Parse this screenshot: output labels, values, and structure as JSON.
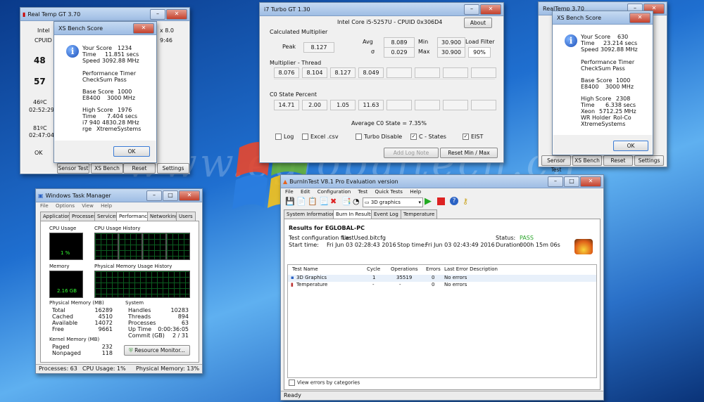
{
  "desktop": {
    "watermark": "www.eglobaltech.cn"
  },
  "realtemp_left": {
    "title": "Real Temp GT 3.70",
    "intel_label": "Intel",
    "cpuid_label": "CPUID",
    "frag_x8": "x 8.0",
    "frag_46": "9:46",
    "temp1": "48",
    "temp2": "57",
    "min_temp": "46ºC",
    "min_time": "02:52:29",
    "max_temp": "81ºC",
    "max_time": "02:47:04",
    "ok": "OK",
    "buttons": {
      "sensor_test": "Sensor Test",
      "xs_bench": "XS Bench",
      "reset": "Reset",
      "settings": "Settings"
    }
  },
  "xs_bench_left": {
    "title": "XS Bench Score",
    "your_score_label": "Your Score",
    "your_score": "1234",
    "time_label": "Time",
    "time": "11.851 secs",
    "speed_label": "Speed",
    "speed": "3092.88 MHz",
    "perf_timer": "Performance Timer",
    "checksum": "CheckSum Pass",
    "base_score_label": "Base Score",
    "base_score": "1000",
    "base_cpu": "E8400",
    "base_mhz": "3000 MHz",
    "high_score_label": "High Score",
    "high_score": "1976",
    "high_time_label": "Time",
    "high_time": "7.404 secs",
    "high_cpu": "i7 940",
    "high_mhz": "4830.28 MHz",
    "holder": "rge",
    "holder_name": "XtremeSystems",
    "ok": "OK"
  },
  "i7turbo": {
    "title": "i7 Turbo GT 1.30",
    "cpu_info": "Intel Core i5-5257U  -  CPUID 0x306D4",
    "about": "About",
    "calc_mult": "Calculated Multiplier",
    "peak_label": "Peak",
    "peak": "8.127",
    "avg_label": "Avg",
    "avg": "8.089",
    "min_label": "Min",
    "min": "30.900",
    "load_filter_label": "Load Filter",
    "sigma_label": "σ",
    "sigma": "0.029",
    "max_label": "Max",
    "max": "30.900",
    "load_filter": "90%",
    "mult_thread": "Multiplier - Thread",
    "threads": [
      "8.076",
      "8.104",
      "8.127",
      "8.049",
      "",
      "",
      "",
      ""
    ],
    "c0_label": "C0 State Percent",
    "c0": [
      "14.71",
      "2.00",
      "1.05",
      "11.63",
      "",
      "",
      "",
      ""
    ],
    "avg_c0": "Average C0 State = 7.35%",
    "log": "Log",
    "excel": "Excel .csv",
    "turbo_disable": "Turbo Disable",
    "c_states": "C - States",
    "eist": "EIST",
    "add_log_note": "Add Log Note",
    "reset_min_max": "Reset Min / Max"
  },
  "realtemp_right": {
    "title": "RealTemp 3.70",
    "buttons": {
      "sensor_test": "Sensor Test",
      "xs_bench": "XS Bench",
      "reset": "Reset",
      "settings": "Settings"
    }
  },
  "xs_bench_right": {
    "title": "XS Bench Score",
    "your_score_label": "Your Score",
    "your_score": "630",
    "time_label": "Time",
    "time": "23.214 secs",
    "speed_label": "Speed",
    "speed": "3092.88 MHz",
    "perf_timer": "Performance Timer",
    "checksum": "CheckSum Pass",
    "base_score_label": "Base Score",
    "base_score": "1000",
    "base_cpu": "E8400",
    "base_mhz": "3000 MHz",
    "high_score_label": "High Score",
    "high_score": "2308",
    "high_time_label": "Time",
    "high_time": "6.338 secs",
    "high_cpu": "Xeon",
    "high_mhz": "5712.25 MHz",
    "holder_label": "WR Holder",
    "holder": "Rol-Co",
    "holder_name": "XtremeSystems",
    "ok": "OK"
  },
  "taskmgr": {
    "title": "Windows Task Manager",
    "menu": [
      "File",
      "Options",
      "View",
      "Help"
    ],
    "tabs": [
      "Applications",
      "Processes",
      "Services",
      "Performance",
      "Networking",
      "Users"
    ],
    "cpu_usage_label": "CPU Usage",
    "cpu_usage_value": "1 %",
    "cpu_history_label": "CPU Usage History",
    "memory_label": "Memory",
    "memory_value": "2.16 GB",
    "mem_history_label": "Physical Memory Usage History",
    "phys_mem_label": "Physical Memory (MB)",
    "phys": [
      [
        "Total",
        "16289"
      ],
      [
        "Cached",
        "4510"
      ],
      [
        "Available",
        "14072"
      ],
      [
        "Free",
        "9661"
      ]
    ],
    "system_label": "System",
    "system": [
      [
        "Handles",
        "10283"
      ],
      [
        "Threads",
        "894"
      ],
      [
        "Processes",
        "63"
      ],
      [
        "Up Time",
        "0:00:36:05"
      ],
      [
        "Commit (GB)",
        "2 / 31"
      ]
    ],
    "kernel_label": "Kernel Memory (MB)",
    "kernel": [
      [
        "Paged",
        "232"
      ],
      [
        "Nonpaged",
        "118"
      ]
    ],
    "resource_monitor": "Resource Monitor...",
    "status": {
      "processes": "Processes: 63",
      "cpu": "CPU Usage: 1%",
      "memory": "Physical Memory: 13%"
    }
  },
  "burnin": {
    "title": "BurnInTest V8.1 Pro Evaluation version",
    "menu": [
      "File",
      "Edit",
      "Configuration",
      "Test",
      "Quick Tests",
      "Help"
    ],
    "toolbar_select": "3D graphics",
    "tabs": [
      "System Information",
      "Burn In Results",
      "Event Log",
      "Temperature"
    ],
    "results_for": "Results for EGLOBAL-PC",
    "config_label": "Test configuration file:",
    "config_value": "LastUsed.bitcfg",
    "start_label": "Start time:",
    "start_value": "Fri Jun 03 02:28:43 2016",
    "stop_label": "Stop time:",
    "stop_value": "Fri Jun 03 02:43:49 2016",
    "status_label": "Status:",
    "status_value": "PASS",
    "duration_label": "Duration:",
    "duration_value": "000h 15m 06s",
    "columns": [
      "Test Name",
      "Cycle",
      "Operations",
      "Errors",
      "Last Error Description"
    ],
    "rows": [
      [
        "3D Graphics",
        "1",
        "35519",
        "0",
        "No errors"
      ],
      [
        "Temperature",
        "-",
        "-",
        "0",
        "No errors"
      ]
    ],
    "view_errors": "View errors by categories",
    "status_bar": "Ready",
    "pass_color": "#2aa52a"
  }
}
